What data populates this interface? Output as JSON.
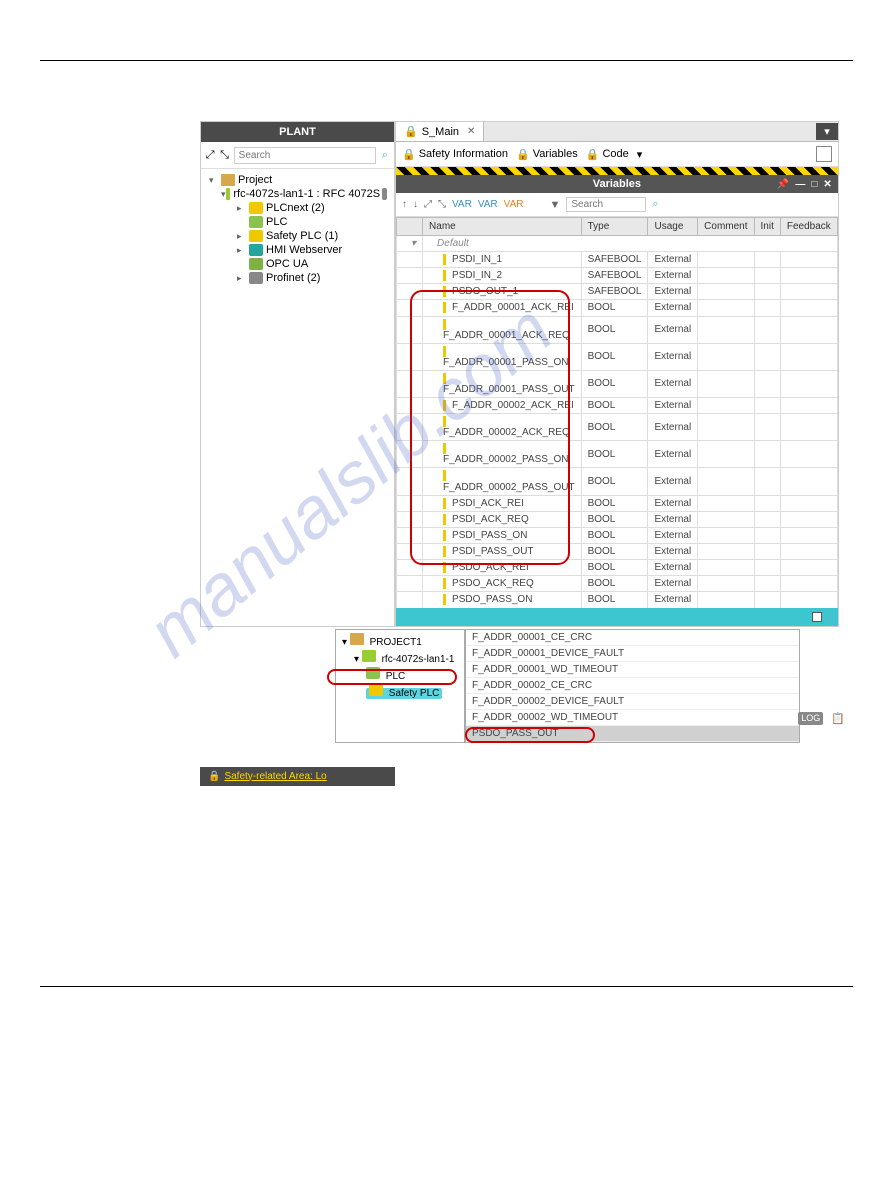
{
  "plant": {
    "title": "PLANT",
    "search_placeholder": "Search",
    "tree": {
      "project": "Project",
      "device": "rfc-4072s-lan1-1 : RFC 4072S",
      "plcnext": "PLCnext (2)",
      "plc": "PLC",
      "safety_plc": "Safety PLC (1)",
      "hmi": "HMI Webserver",
      "opc": "OPC UA",
      "profinet": "Profinet (2)"
    }
  },
  "main": {
    "tab_label": "S_Main",
    "toolbar": {
      "safety_info": "Safety Information",
      "variables": "Variables",
      "code": "Code"
    },
    "variables_header": "Variables",
    "var_search_placeholder": "Search",
    "columns": {
      "name": "Name",
      "type": "Type",
      "usage": "Usage",
      "comment": "Comment",
      "init": "Init",
      "feedback": "Feedback"
    },
    "default_label": "Default",
    "rows": [
      {
        "name": "PSDI_IN_1",
        "type": "SAFEBOOL",
        "usage": "External"
      },
      {
        "name": "PSDI_IN_2",
        "type": "SAFEBOOL",
        "usage": "External"
      },
      {
        "name": "PSDO_OUT_1",
        "type": "SAFEBOOL",
        "usage": "External"
      },
      {
        "name": "F_ADDR_00001_ACK_REI",
        "type": "BOOL",
        "usage": "External"
      },
      {
        "name": "F_ADDR_00001_ACK_REQ",
        "type": "BOOL",
        "usage": "External"
      },
      {
        "name": "F_ADDR_00001_PASS_ON",
        "type": "BOOL",
        "usage": "External"
      },
      {
        "name": "F_ADDR_00001_PASS_OUT",
        "type": "BOOL",
        "usage": "External"
      },
      {
        "name": "F_ADDR_00002_ACK_REI",
        "type": "BOOL",
        "usage": "External"
      },
      {
        "name": "F_ADDR_00002_ACK_REQ",
        "type": "BOOL",
        "usage": "External"
      },
      {
        "name": "F_ADDR_00002_PASS_ON",
        "type": "BOOL",
        "usage": "External"
      },
      {
        "name": "F_ADDR_00002_PASS_OUT",
        "type": "BOOL",
        "usage": "External"
      },
      {
        "name": "PSDI_ACK_REI",
        "type": "BOOL",
        "usage": "External"
      },
      {
        "name": "PSDI_ACK_REQ",
        "type": "BOOL",
        "usage": "External"
      },
      {
        "name": "PSDI_PASS_ON",
        "type": "BOOL",
        "usage": "External"
      },
      {
        "name": "PSDI_PASS_OUT",
        "type": "BOOL",
        "usage": "External"
      },
      {
        "name": "PSDO_ACK_REI",
        "type": "BOOL",
        "usage": "External"
      },
      {
        "name": "PSDO_ACK_REQ",
        "type": "BOOL",
        "usage": "External"
      },
      {
        "name": "PSDO_PASS_ON",
        "type": "BOOL",
        "usage": "External"
      }
    ]
  },
  "mini_tree": {
    "project": "PROJECT1",
    "device": "rfc-4072s-lan1-1",
    "plc": "PLC",
    "safety_plc": "Safety PLC"
  },
  "addr_list": [
    "F_ADDR_00001_CE_CRC",
    "F_ADDR_00001_DEVICE_FAULT",
    "F_ADDR_00001_WD_TIMEOUT",
    "F_ADDR_00002_CE_CRC",
    "F_ADDR_00002_DEVICE_FAULT",
    "F_ADDR_00002_WD_TIMEOUT",
    "PSDO_PASS_OUT"
  ],
  "footer": {
    "text": "Safety-related Area: Lo"
  }
}
